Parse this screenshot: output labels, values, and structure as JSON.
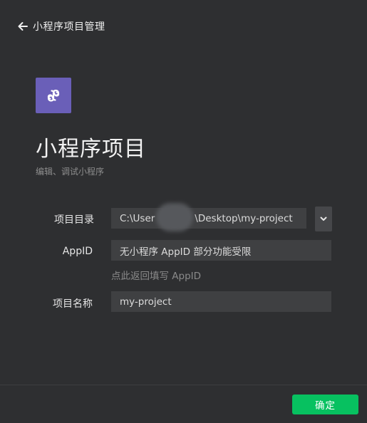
{
  "header": {
    "back_icon": "arrow-left-icon",
    "title": "小程序项目管理"
  },
  "project": {
    "logo_icon": "mini-program-logo-icon",
    "logo_color": "#6a5fb8",
    "title": "小程序项目",
    "subtitle": "编辑、调试小程序"
  },
  "form": {
    "directory": {
      "label": "项目目录",
      "value_prefix": "C:\\User",
      "value_suffix": "\\Desktop\\my-project",
      "dropdown_icon": "chevron-down-icon"
    },
    "appid": {
      "label": "AppID",
      "value": "无小程序 AppID 部分功能受限",
      "hint": "点此返回填写 AppID"
    },
    "name": {
      "label": "项目名称",
      "value": "my-project"
    }
  },
  "footer": {
    "confirm_label": "确定",
    "confirm_color": "#07c160"
  }
}
